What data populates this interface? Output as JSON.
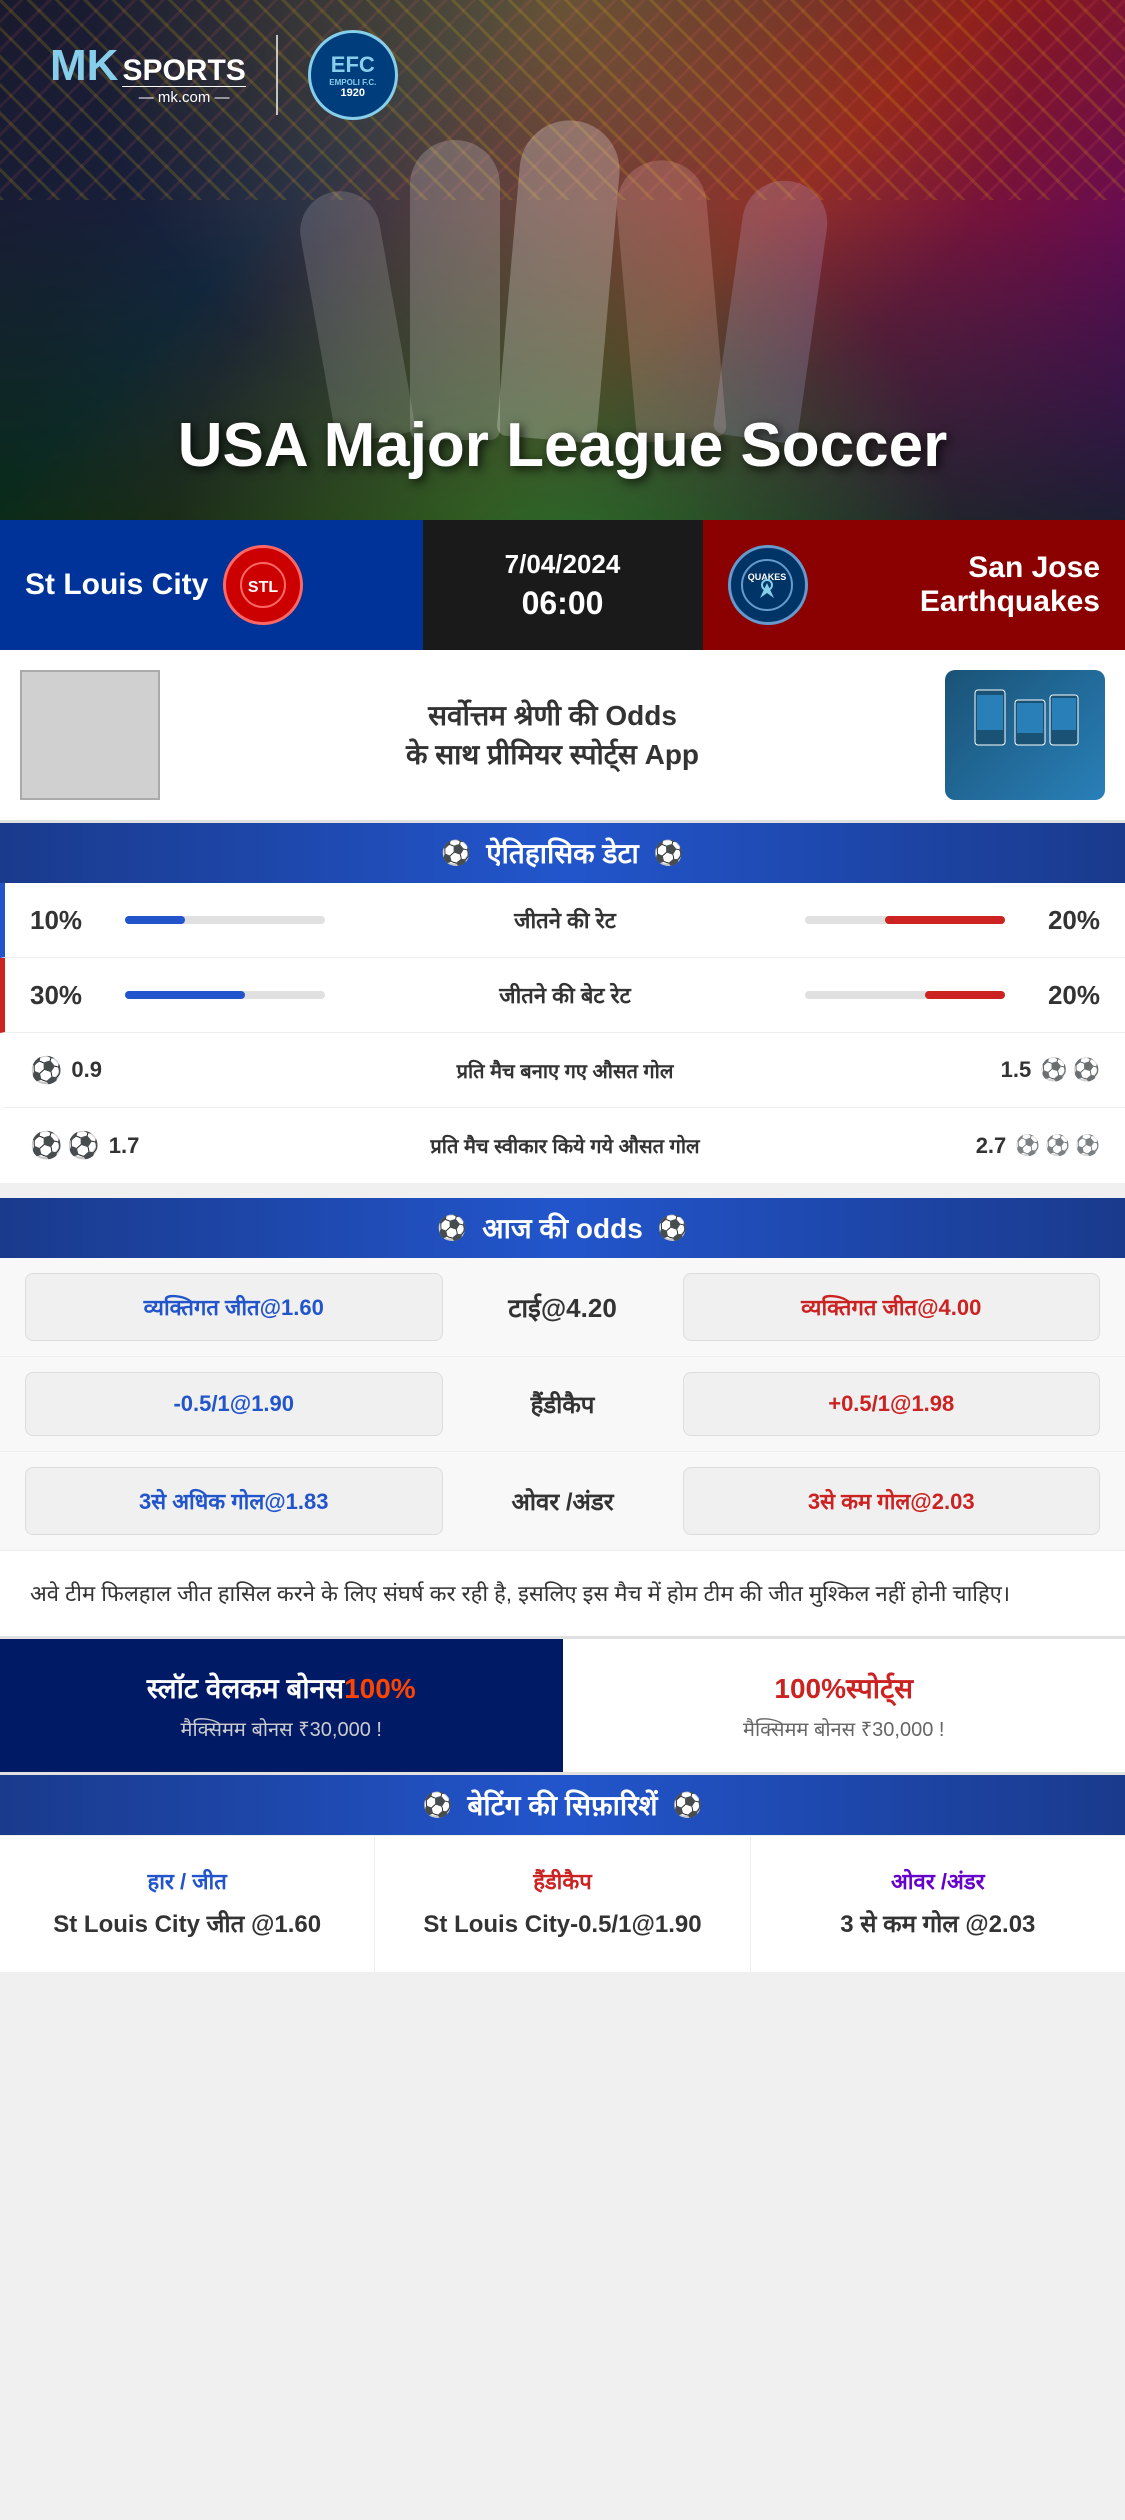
{
  "brand": {
    "mk_label": "MK",
    "sports_label": "SPORTS",
    "domain": "mk.com",
    "empoli_top": "EMPOLI F.C.",
    "empoli_year": "1920",
    "empoli_letters": "EFC"
  },
  "hero": {
    "title": "USA Major League Soccer"
  },
  "match": {
    "home_team": "St Louis City",
    "away_team": "San Jose Earthquakes",
    "away_team_short": "QUAKES",
    "date": "7/04/2024",
    "time": "06:00"
  },
  "promo": {
    "text_line1": "सर्वोत्तम श्रेणी की Odds",
    "text_line2": "के साथ प्रीमियर स्पोर्ट्स App"
  },
  "historical": {
    "section_title": "ऐतिहासिक डेटा",
    "rows": [
      {
        "left_val": "10%",
        "label": "जीतने की रेट",
        "right_val": "20%",
        "left_width": "30",
        "right_width": "60"
      },
      {
        "left_val": "30%",
        "label": "जीतने की बेट रेट",
        "right_val": "20%",
        "left_width": "60",
        "right_width": "40"
      },
      {
        "left_val": "0.9",
        "label": "प्रति मैच बनाए गए औसत गोल",
        "right_val": "1.5",
        "left_icons": 1,
        "right_icons": 2
      },
      {
        "left_val": "1.7",
        "label": "प्रति मैच स्वीकार किये गये औसत गोल",
        "right_val": "2.7",
        "left_icons": 2,
        "right_icons": 3
      }
    ]
  },
  "odds": {
    "section_title": "आज की odds",
    "rows": [
      {
        "left_label": "व्यक्तिगत जीत@1.60",
        "center_label": "टाई@4.20",
        "right_label": "व्यक्तिगत जीत@4.00"
      },
      {
        "left_label": "-0.5/1@1.90",
        "center_label": "हैंडीकैप",
        "right_label": "+0.5/1@1.98"
      },
      {
        "left_label": "3से अधिक गोल@1.83",
        "center_label": "ओवर /अंडर",
        "right_label": "3से कम गोल@2.03"
      }
    ]
  },
  "analysis": {
    "text": "अवे टीम फिलहाल जीत हासिल करने के लिए संघर्ष कर रही है, इसलिए इस मैच में होम टीम की जीत मुश्किल नहीं होनी चाहिए।"
  },
  "bonus": {
    "left_title": "स्लॉट वेलकम बोनस",
    "left_percent": "100%",
    "left_sub": "मैक्सिमम बोनस ₹30,000  !",
    "right_title": "100%स्पोर्ट्स",
    "right_sub": "मैक्सिमम बोनस  ₹30,000 !"
  },
  "recommendations": {
    "section_title": "बेटिंग की सिफ़ारिशें",
    "cols": [
      {
        "type": "हार / जीत",
        "value": "St Louis City जीत @1.60"
      },
      {
        "type": "हैंडीकैप",
        "value": "St Louis City-0.5/1@1.90"
      },
      {
        "type": "ओवर /अंडर",
        "value": "3 से कम गोल @2.03"
      }
    ]
  }
}
